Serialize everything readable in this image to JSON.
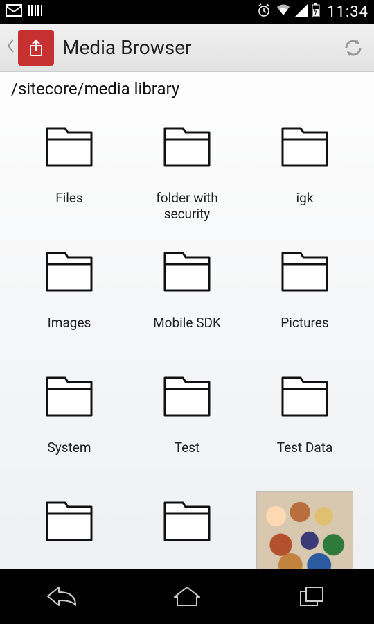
{
  "status": {
    "time": "11:34"
  },
  "header": {
    "title": "Media Browser"
  },
  "path": "/sitecore/media library",
  "items": [
    {
      "type": "folder",
      "label": "Files"
    },
    {
      "type": "folder",
      "label": "folder with security"
    },
    {
      "type": "folder",
      "label": "igk"
    },
    {
      "type": "folder",
      "label": "Images"
    },
    {
      "type": "folder",
      "label": "Mobile SDK"
    },
    {
      "type": "folder",
      "label": "Pictures"
    },
    {
      "type": "folder",
      "label": "System"
    },
    {
      "type": "folder",
      "label": "Test"
    },
    {
      "type": "folder",
      "label": "Test Data"
    },
    {
      "type": "folder",
      "label": ""
    },
    {
      "type": "folder",
      "label": ""
    },
    {
      "type": "image",
      "label": ""
    }
  ]
}
